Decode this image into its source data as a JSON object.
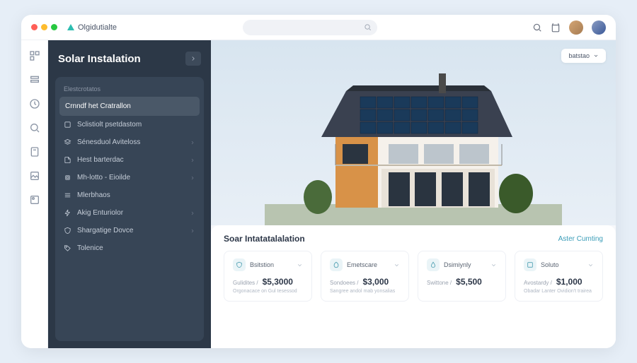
{
  "brand": "Olgidutialte",
  "sidebar": {
    "title": "Solar Instalation",
    "section_label": "Elestcrotatos",
    "items": [
      {
        "label": "Crnndf het Cratrallon",
        "icon": "none",
        "active": true
      },
      {
        "label": "Sclistiolt psetdastom",
        "icon": "box"
      },
      {
        "label": "Sénesduol Aviteloss",
        "icon": "layers",
        "chev": true
      },
      {
        "label": "Hest barterdac",
        "icon": "file",
        "chev": true
      },
      {
        "label": "Mh-lotto - Eioilde",
        "icon": "cpu",
        "chev": true
      },
      {
        "label": "Mlerbhaos",
        "icon": "menu"
      },
      {
        "label": "Akig Enturiolor",
        "icon": "bolt",
        "chev": true
      },
      {
        "label": "Shargatige Dovce",
        "icon": "shield",
        "chev": true
      },
      {
        "label": "Tolenice",
        "icon": "tag"
      }
    ]
  },
  "filter_label": "batstao",
  "bottom": {
    "title": "Soar Intatatalalation",
    "link": "Aster Cumting",
    "metrics": [
      {
        "icon": "shield",
        "label": "Bsitstion",
        "sub": "Gulidites",
        "price": "$5,3000",
        "desc": "Orgonacace on Gul tesessod"
      },
      {
        "icon": "leaf",
        "label": "Emetscare",
        "sub": "Sondoees",
        "price": "$3,000",
        "desc": "Sangree andol mab yonsalias"
      },
      {
        "icon": "drop",
        "label": "Dsimiynly",
        "sub": "Swittone",
        "price": "$5,500",
        "desc": ""
      },
      {
        "icon": "box",
        "label": "Soluto",
        "sub": "Avostardy",
        "price": "$1,000",
        "desc": "Obadar Lanter Ovidion't trairea"
      }
    ]
  }
}
